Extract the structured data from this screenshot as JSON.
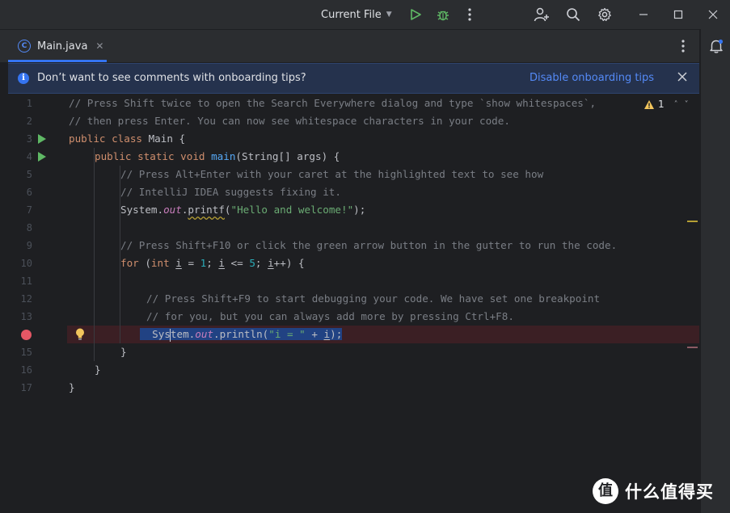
{
  "titlebar": {
    "run_config": "Current File",
    "icons": [
      "run-icon",
      "debug-icon",
      "more-vertical-icon",
      "add-user-icon",
      "search-icon",
      "settings-icon",
      "minimize-icon",
      "maximize-icon",
      "close-icon"
    ]
  },
  "tabs": [
    {
      "label": "Main.java",
      "icon": "java-class-icon",
      "badge": "C",
      "active": true
    }
  ],
  "banner": {
    "text": "Don’t want to see comments with onboarding tips?",
    "link": "Disable onboarding tips"
  },
  "inspection": {
    "warning_count": "1"
  },
  "line_numbers": [
    "1",
    "2",
    "3",
    "4",
    "5",
    "6",
    "7",
    "8",
    "9",
    "10",
    "11",
    "12",
    "13",
    "14",
    "15",
    "16",
    "17"
  ],
  "code": {
    "l1": "// Press Shift twice to open the Search Everywhere dialog and type `show whitespaces`,",
    "l2": "// then press Enter. You can now see whitespace characters in your code.",
    "l3_kw": "public class",
    "l3_rest": " Main {",
    "l4_kw": "public static void",
    "l4_fn": "main",
    "l4_rest": "(String[] args) {",
    "l5": "// Press Alt+Enter with your caret at the highlighted text to see how",
    "l6": "// IntelliJ IDEA suggests fixing it.",
    "l7_a": "System.",
    "l7_field": "out",
    "l7_dot": ".",
    "l7_method": "printf",
    "l7_open": "(",
    "l7_str": "\"Hello and welcome!\"",
    "l7_close": ");",
    "l9": "// Press Shift+F10 or click the green arrow button in the gutter to run the code.",
    "l10_for": "for",
    "l10_open": " (",
    "l10_int": "int",
    "l10_sp": " ",
    "l10_i1": "i",
    "l10_eq": " = ",
    "l10_n1": "1",
    "l10_semi1": "; ",
    "l10_i2": "i",
    "l10_le": " <= ",
    "l10_n5": "5",
    "l10_semi2": "; ",
    "l10_i3": "i",
    "l10_end": "++) {",
    "l12": "// Press Shift+F9 to start debugging your code. We have set one breakpoint",
    "l13": "// for you, but you can always add more by pressing Ctrl+F8.",
    "l14_a": "Sys",
    "l14_b": "tem.",
    "l14_field": "out",
    "l14_c": ".println(",
    "l14_str": "\"i = \"",
    "l14_plus": " + ",
    "l14_i": "i",
    "l14_close": ");",
    "brace": "}"
  },
  "watermark": {
    "badge": "值",
    "text": "什么值得买"
  },
  "colors": {
    "background": "#1e1f22",
    "accent": "#3574f0",
    "comment": "#7a7e85",
    "keyword": "#cf8e6d",
    "string": "#6aab73",
    "breakpoint": "#e55765",
    "run_gutter": "#5fb865"
  }
}
